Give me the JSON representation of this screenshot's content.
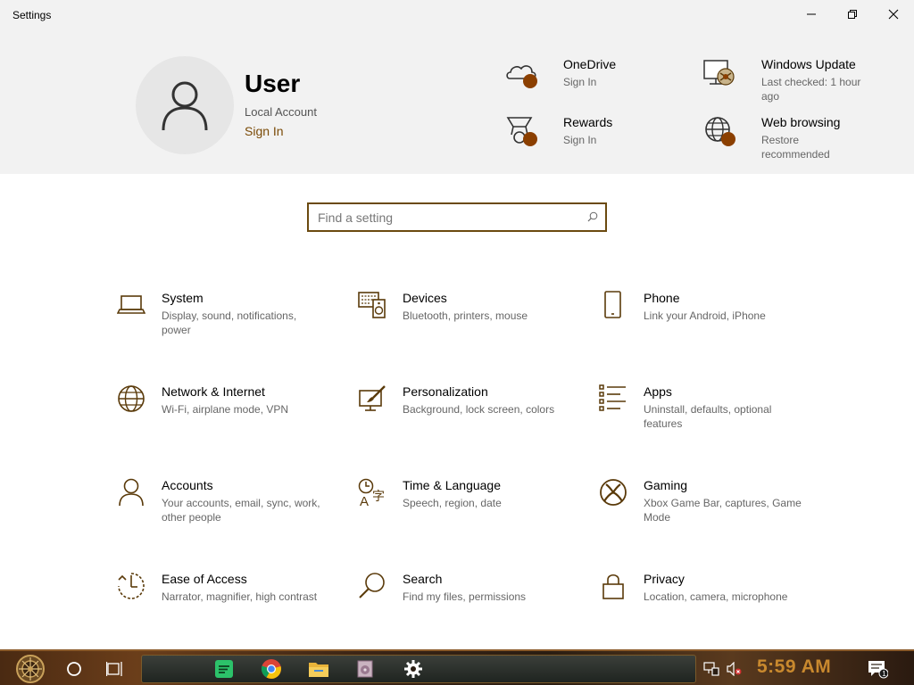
{
  "window": {
    "title": "Settings",
    "minimize_icon": "minimize-icon",
    "maximize_icon": "restore-icon",
    "close_icon": "close-icon"
  },
  "header": {
    "user_name": "User",
    "account_type": "Local Account",
    "sign_in": "Sign In",
    "items": [
      {
        "title": "OneDrive",
        "subtitle": "Sign In",
        "icon": "cloud-icon"
      },
      {
        "title": "Windows Update",
        "subtitle": "Last checked: 1 hour ago",
        "icon": "windows-update-icon"
      },
      {
        "title": "Rewards",
        "subtitle": "Sign In",
        "icon": "trophy-icon"
      },
      {
        "title": "Web browsing",
        "subtitle": "Restore recommended",
        "icon": "globe-icon"
      }
    ]
  },
  "search": {
    "placeholder": "Find a setting"
  },
  "tiles": [
    {
      "title": "System",
      "subtitle": "Display, sound, notifications, power",
      "icon": "laptop-icon"
    },
    {
      "title": "Devices",
      "subtitle": "Bluetooth, printers, mouse",
      "icon": "devices-icon"
    },
    {
      "title": "Phone",
      "subtitle": "Link your Android, iPhone",
      "icon": "phone-icon"
    },
    {
      "title": "Network & Internet",
      "subtitle": "Wi-Fi, airplane mode, VPN",
      "icon": "globe-icon"
    },
    {
      "title": "Personalization",
      "subtitle": "Background, lock screen, colors",
      "icon": "paint-icon"
    },
    {
      "title": "Apps",
      "subtitle": "Uninstall, defaults, optional features",
      "icon": "apps-list-icon"
    },
    {
      "title": "Accounts",
      "subtitle": "Your accounts, email, sync, work, other people",
      "icon": "person-icon"
    },
    {
      "title": "Time & Language",
      "subtitle": "Speech, region, date",
      "icon": "time-language-icon"
    },
    {
      "title": "Gaming",
      "subtitle": "Xbox Game Bar, captures, Game Mode",
      "icon": "xbox-icon"
    },
    {
      "title": "Ease of Access",
      "subtitle": "Narrator, magnifier, high contrast",
      "icon": "ease-of-access-icon"
    },
    {
      "title": "Search",
      "subtitle": "Find my files, permissions",
      "icon": "magnifier-icon"
    },
    {
      "title": "Privacy",
      "subtitle": "Location, camera, microphone",
      "icon": "lock-icon"
    }
  ],
  "taskbar": {
    "clock": "5:59 AM",
    "apps": [
      "start-icon",
      "cortana-icon",
      "task-view-icon",
      "spotify-icon",
      "chrome-icon",
      "file-explorer-icon",
      "media-player-icon",
      "settings-gear-icon"
    ],
    "tray": [
      "network-icon",
      "volume-muted-icon",
      "notifications-icon"
    ],
    "notification_count": "1"
  },
  "colors": {
    "accent": "#7a4a06",
    "icon": "#5a3a0a",
    "badge": "#8b3f00",
    "header_bg": "#f2f2f2",
    "search_border": "#6b4a10",
    "clock": "#c9892e"
  }
}
